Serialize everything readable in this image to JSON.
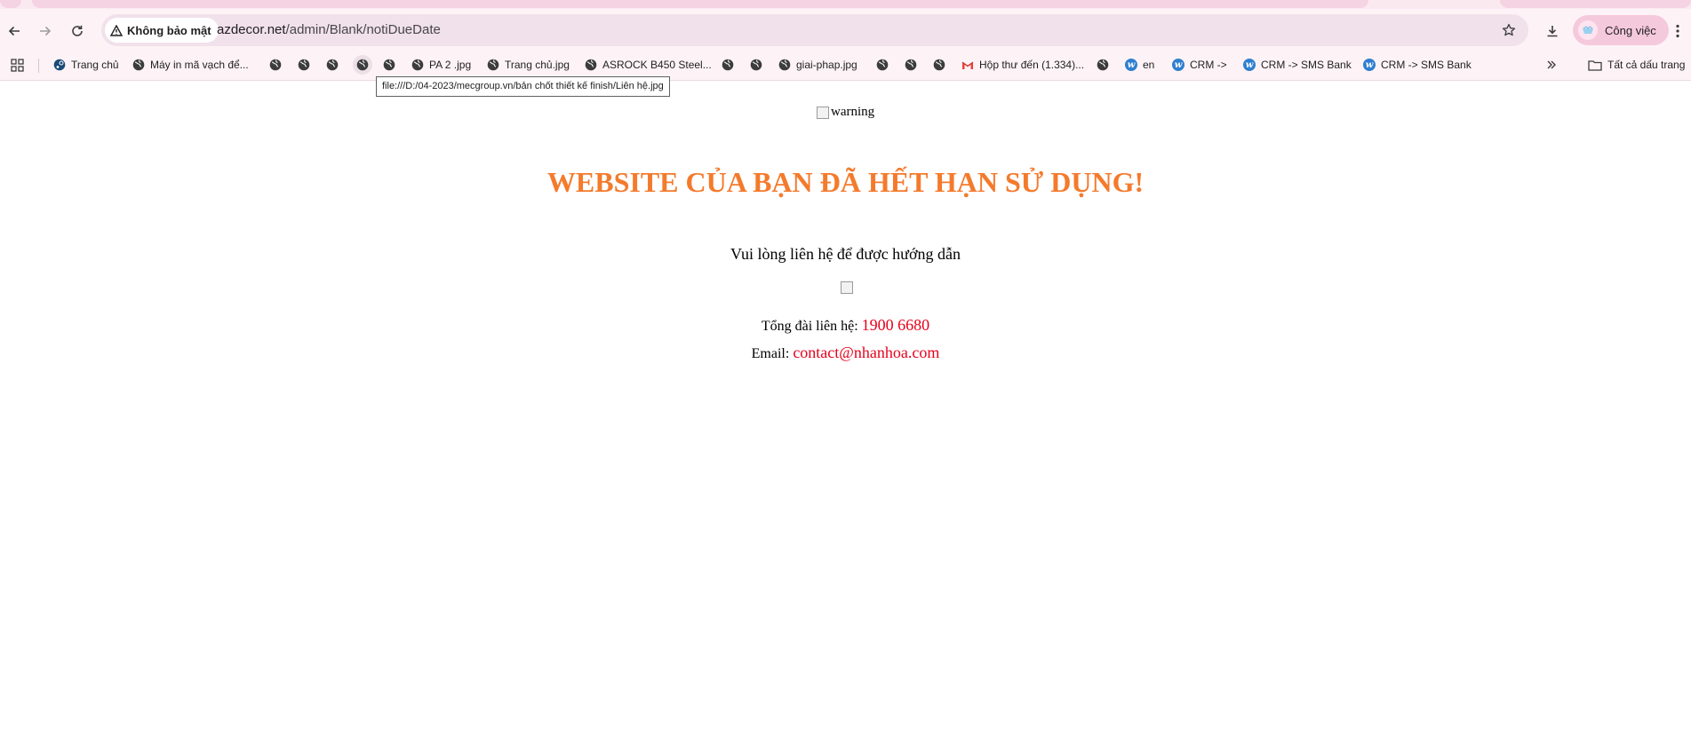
{
  "browser": {
    "security_label": "Không bảo mật",
    "url_host": "azdecor.net",
    "url_path": "/admin/Blank/notiDueDate",
    "profile_label": "Công việc"
  },
  "bookmarks": {
    "items": [
      {
        "label": "Trang chủ",
        "icon": "steam-icon"
      },
      {
        "label": "Máy in mã vạch để...",
        "icon": "globe-icon"
      },
      {
        "label": "",
        "icon": "globe-icon"
      },
      {
        "label": "",
        "icon": "globe-icon"
      },
      {
        "label": "",
        "icon": "globe-icon"
      },
      {
        "label": "",
        "icon": "globe-icon"
      },
      {
        "label": "",
        "icon": "globe-icon"
      },
      {
        "label": "PA 2 .jpg",
        "icon": "globe-icon"
      },
      {
        "label": "Trang chủ.jpg",
        "icon": "globe-icon"
      },
      {
        "label": "ASROCK B450 Steel...",
        "icon": "globe-icon"
      },
      {
        "label": "",
        "icon": "globe-icon"
      },
      {
        "label": "",
        "icon": "globe-icon"
      },
      {
        "label": "giai-phap.jpg",
        "icon": "globe-icon"
      },
      {
        "label": "",
        "icon": "globe-icon"
      },
      {
        "label": "",
        "icon": "globe-icon"
      },
      {
        "label": "",
        "icon": "globe-icon"
      },
      {
        "label": "Hộp thư đến (1.334)...",
        "icon": "gmail-icon"
      },
      {
        "label": "",
        "icon": "globe-icon"
      },
      {
        "label": "en",
        "icon": "wordpress-icon"
      },
      {
        "label": "CRM ->",
        "icon": "wordpress-icon"
      },
      {
        "label": "CRM -> SMS Bank",
        "icon": "wordpress-icon"
      },
      {
        "label": "CRM -> SMS Bank",
        "icon": "wordpress-icon"
      }
    ],
    "all_bookmarks_label": "Tất cả dấu trang",
    "tooltip": "file:///D:/04-2023/mecgroup.vn/bản chốt thiết kế finish/Liên hệ.jpg"
  },
  "page": {
    "warning_alt": "warning",
    "heading": "WEBSITE CỦA BẠN ĐÃ HẾT HẠN SỬ DỤNG!",
    "subtext": "Vui lòng liên hệ để được hướng dẫn",
    "phone_label": "Tổng đài liên hệ:",
    "phone_value": "1900 6680",
    "email_label": "Email:",
    "email_value": "contact@nhanhoa.com"
  },
  "colors": {
    "heading": "#f47a2c",
    "contact_value": "#e8001c",
    "chrome_bg": "#fdf3f7",
    "omnibox_bg": "#f1e1ea"
  }
}
